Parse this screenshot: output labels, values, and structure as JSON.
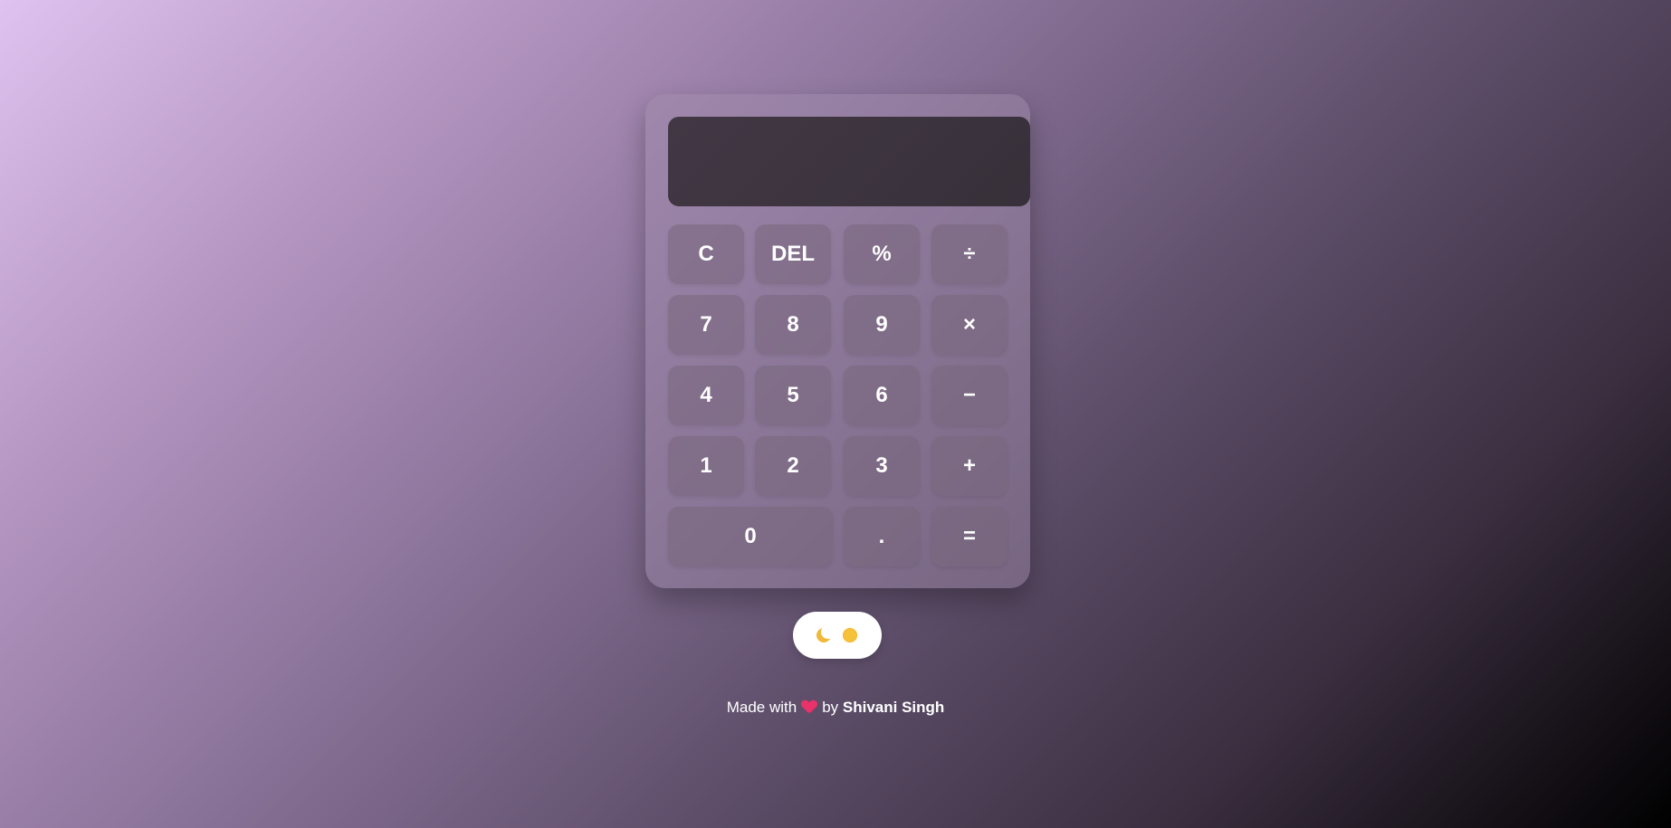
{
  "display": {
    "value": ""
  },
  "keys": {
    "clear": "C",
    "delete": "DEL",
    "percent": "%",
    "divide": "÷",
    "seven": "7",
    "eight": "8",
    "nine": "9",
    "multiply": "×",
    "four": "4",
    "five": "5",
    "six": "6",
    "minus": "−",
    "one": "1",
    "two": "2",
    "three": "3",
    "plus": "+",
    "zero": "0",
    "decimal": ".",
    "equals": "="
  },
  "theme_toggle": {
    "icons": [
      "moon-icon",
      "sun-icon"
    ]
  },
  "footer": {
    "prefix": "Made with",
    "middle": "by",
    "author": "Shivani Singh",
    "heart_color": "#e8326a"
  }
}
